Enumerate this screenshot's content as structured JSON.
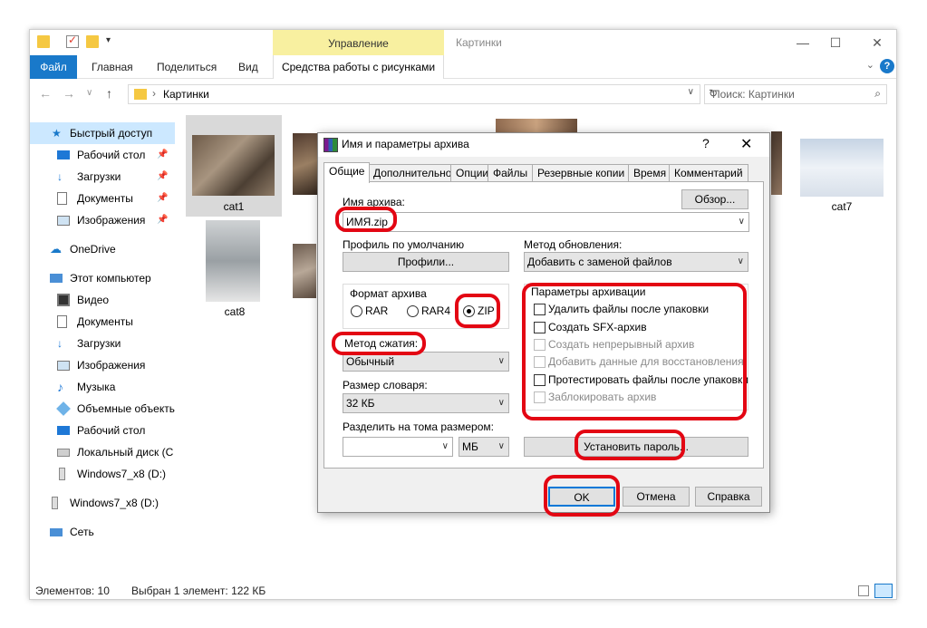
{
  "window": {
    "title": "Картинки",
    "context_tab": "Управление",
    "context_subtab": "Средства работы с рисунками",
    "ribbon_tabs": [
      "Файл",
      "Главная",
      "Поделиться",
      "Вид"
    ],
    "min_label": "—",
    "max_label": "☐",
    "close_label": "✕"
  },
  "address": {
    "path": "Картинки",
    "search_placeholder": "Поиск: Картинки"
  },
  "sidebar": {
    "items": [
      {
        "label": "Быстрый доступ",
        "icon": "star-icon"
      },
      {
        "label": "Рабочий стол",
        "icon": "desktop-icon"
      },
      {
        "label": "Загрузки",
        "icon": "download-icon"
      },
      {
        "label": "Документы",
        "icon": "document-icon"
      },
      {
        "label": "Изображения",
        "icon": "pictures-icon"
      },
      {
        "label": "OneDrive",
        "icon": "cloud-icon"
      },
      {
        "label": "Этот компьютер",
        "icon": "computer-icon"
      },
      {
        "label": "Видео",
        "icon": "video-icon"
      },
      {
        "label": "Документы",
        "icon": "document-icon"
      },
      {
        "label": "Загрузки",
        "icon": "download-icon"
      },
      {
        "label": "Изображения",
        "icon": "pictures-icon"
      },
      {
        "label": "Музыка",
        "icon": "music-icon"
      },
      {
        "label": "Объемные объекты",
        "icon": "3d-objects-icon"
      },
      {
        "label": "Рабочий стол",
        "icon": "desktop-icon"
      },
      {
        "label": "Локальный диск (C",
        "icon": "drive-icon"
      },
      {
        "label": "Windows7_x8 (D:)",
        "icon": "drive-icon"
      },
      {
        "label": "Windows7_x8 (D:)",
        "icon": "drive-icon"
      },
      {
        "label": "Сеть",
        "icon": "network-icon"
      }
    ]
  },
  "files": [
    {
      "name": "cat1"
    },
    {
      "name": "cat7"
    },
    {
      "name": "cat8"
    }
  ],
  "status": {
    "count": "Элементов: 10",
    "selected": "Выбран 1 элемент: 122 КБ"
  },
  "dialog": {
    "title": "Имя и параметры архива",
    "help": "?",
    "close": "✕",
    "tabs": [
      "Общие",
      "Дополнительно",
      "Опции",
      "Файлы",
      "Резервные копии",
      "Время",
      "Комментарий"
    ],
    "archive_name_label": "Имя архива:",
    "archive_name_value": "ИМЯ.zip",
    "browse_button": "Обзор...",
    "profile_label": "Профиль по умолчанию",
    "profiles_button": "Профили...",
    "update_method_label": "Метод обновления:",
    "update_method_value": "Добавить с заменой файлов",
    "format_label": "Формат архива",
    "formats": [
      "RAR",
      "RAR4",
      "ZIP"
    ],
    "selected_format": "ZIP",
    "compression_label": "Метод сжатия:",
    "compression_value": "Обычный",
    "dict_label": "Размер словаря:",
    "dict_value": "32 КБ",
    "split_label": "Разделить на тома размером:",
    "split_value": "",
    "split_unit": "МБ",
    "options_label": "Параметры архивации",
    "options": [
      {
        "label": "Удалить файлы после упаковки",
        "enabled": true
      },
      {
        "label": "Создать SFX-архив",
        "enabled": true
      },
      {
        "label": "Создать непрерывный архив",
        "enabled": false
      },
      {
        "label": "Добавить данные для восстановления",
        "enabled": false
      },
      {
        "label": "Протестировать файлы после упаковки",
        "enabled": true
      },
      {
        "label": "Заблокировать архив",
        "enabled": false
      }
    ],
    "set_password_button": "Установить пароль...",
    "ok_button": "OK",
    "cancel_button": "Отмена",
    "help_button": "Справка"
  },
  "colors": {
    "accent": "#1979ca",
    "highlight": "#e30613",
    "selection": "#cce8ff",
    "context_tab": "#f8f0a0"
  }
}
